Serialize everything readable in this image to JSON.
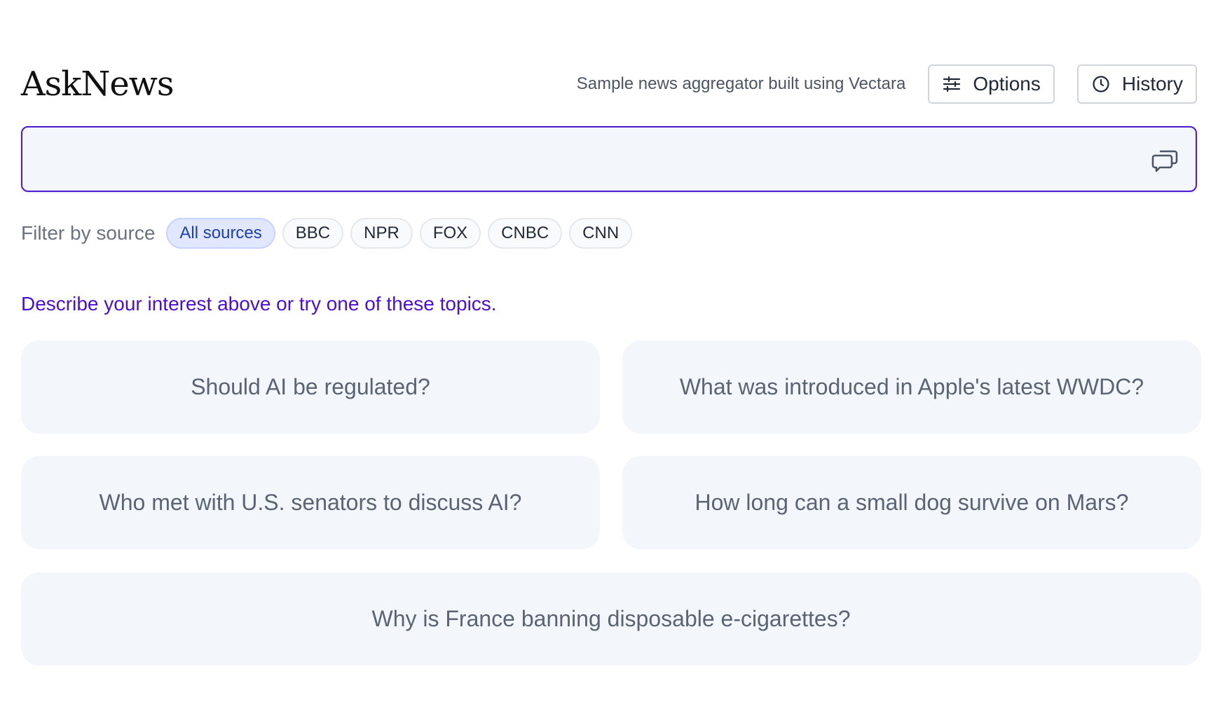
{
  "header": {
    "brand": "AskNews",
    "tagline": "Sample news aggregator built using Vectara",
    "options_label": "Options",
    "options_icon": "sliders-icon",
    "history_label": "History",
    "history_icon": "clock-icon"
  },
  "search": {
    "value": "",
    "placeholder": "",
    "icon": "chat-bubbles-icon"
  },
  "filter": {
    "label": "Filter by source",
    "selected": "All sources",
    "sources": [
      "All sources",
      "BBC",
      "NPR",
      "FOX",
      "CNBC",
      "CNN"
    ]
  },
  "prompt": "Describe your interest above or try one of these topics.",
  "topics": [
    "Should AI be regulated?",
    "What was introduced in Apple's latest WWDC?",
    "Who met with U.S. senators to discuss AI?",
    "How long can a small dog survive on Mars?",
    "Why is France banning disposable e-cigarettes?"
  ],
  "colors": {
    "accent": "#4a0fd6",
    "search_border": "#4c1dcf",
    "card_bg": "#f3f6fb",
    "chip_active_bg": "#e0e7ff",
    "chip_active_text": "#1e40af"
  }
}
